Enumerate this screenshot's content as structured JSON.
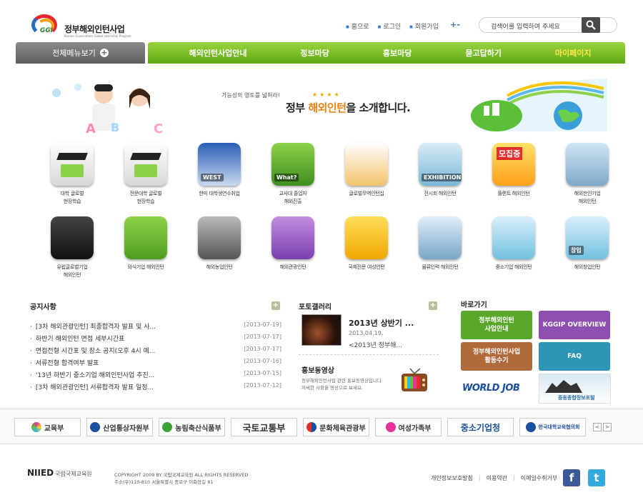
{
  "header": {
    "logo_mark": "GGI",
    "logo_kr": "정부해외인턴사업",
    "logo_en": "Korean Government Global Internship Program",
    "links": [
      "홈으로",
      "로그인",
      "회원가입"
    ],
    "zoom_label": "+-",
    "search_placeholder": "검색어를 입력하여 주세요"
  },
  "nav": {
    "all_menu": "전체메뉴보기",
    "items": [
      "해외인턴사업안내",
      "정보마당",
      "홍보마당",
      "묻고답하기",
      "마이페이지"
    ]
  },
  "banner": {
    "tagline": "가능성의 영토를 넓혀라!",
    "stars": "★★★★",
    "headline_pre": "정부 ",
    "headline_hl": "해외인턴",
    "headline_post": "을 소개합니다."
  },
  "programs": [
    {
      "label": "대학 글로벌\n현장학습",
      "icon": "graduation-cap-icon"
    },
    {
      "label": "전문대학 글로벌\n현장학습",
      "icon": "graduation-cap-icon"
    },
    {
      "label": "한미 대학생연수취업",
      "icon": "west-flag-icon"
    },
    {
      "label": "교사대 졸업자\n해외진출",
      "icon": "question-board-icon"
    },
    {
      "label": "글로벌무역인턴십",
      "icon": "globe-package-icon"
    },
    {
      "label": "전시회 해외인턴",
      "icon": "exhibition-icon"
    },
    {
      "label": "플랜트 해외인턴",
      "icon": "recruit-icon"
    },
    {
      "label": "해외한인기업\n해외인턴",
      "icon": "korea-flag-icon"
    },
    {
      "label": "유럽글로벌기업\n해외인턴",
      "icon": "eu-flag-icon"
    },
    {
      "label": "외식기업 해외인턴",
      "icon": "city-buildings-icon"
    },
    {
      "label": "해외농업인턴",
      "icon": "farm-globe-icon"
    },
    {
      "label": "해외관광인턴",
      "icon": "passport-plane-icon"
    },
    {
      "label": "국제전문 여성인턴",
      "icon": "un-woman-icon"
    },
    {
      "label": "물류인력 해외인턴",
      "icon": "logistics-icon"
    },
    {
      "label": "중소기업 해외인턴",
      "icon": "sme-figure-icon"
    },
    {
      "label": "해외창업인턴",
      "icon": "startup-figure-icon"
    }
  ],
  "program_tile_text": {
    "west": "WEST",
    "what": "What?",
    "exhibition": "EXHIBITION",
    "recruit": "모집중",
    "startup": "창업"
  },
  "notice": {
    "title": "공지사항",
    "more": "+",
    "items": [
      {
        "title": "[3차 해외관광인턴] 최종합격자 발표 및 사...",
        "date": "[2013-07-19]"
      },
      {
        "title": "하반기 해외인턴 면접 세부시간표",
        "date": "[2013-07-17]"
      },
      {
        "title": "면접전형 시간표 및 장소 공지(오후 4시 예...",
        "date": "[2013-07-17]"
      },
      {
        "title": "서류전형 합격여부 발표",
        "date": "[2013-07-16]"
      },
      {
        "title": "'13년 하반기 중소기업 해외인턴사업 추진...",
        "date": "[2013-07-15]"
      },
      {
        "title": "[3차 해외관광인턴] 서류합격자 발표 일정...",
        "date": "[2013-07-12]"
      }
    ]
  },
  "gallery": {
    "title": "포토갤러리",
    "more": "+",
    "item_title": "2013년 상반기 ...",
    "item_date": "2013,04,19,",
    "item_sub": "<2013년 정부해...",
    "video_title": "홍보동영상",
    "video_desc1": "정부해외인턴사업 관련 홍보동영상입니다.",
    "video_desc2": "자세한 사항을 영상으로 보세요."
  },
  "quick": {
    "title": "바로가기",
    "buttons": [
      {
        "label": "정부해외인턴\n사업안내",
        "color": "#5aa82a"
      },
      {
        "label": "KGGIP OVERVIEW",
        "color": "#8e4fb0"
      },
      {
        "label": "정부해외인턴사업\n활동수기",
        "color": "#b06a3c"
      },
      {
        "label": "FAQ",
        "color": "#2d95b5"
      }
    ],
    "worldjob": "WORLD JOB",
    "worldjob_sub": "중동종합정보포털"
  },
  "partners": [
    "교육부",
    "산업통상자원부",
    "농림축산식품부",
    "국토교통부",
    "문화체육관광부",
    "여성가족부",
    "중소기업청",
    "한국대학교육협의회"
  ],
  "partner_nav": [
    "<",
    ">"
  ],
  "footer": {
    "logo": "NIIED",
    "logo_kr": "국립국제교육원",
    "copyright": "COPYRIGHT 2009 BY 국립국제교육원 ALL RIGHTS RESERVED",
    "address": "주소(우)110-810 서울특별시 종로구 이화장길 81",
    "links": [
      "개인정보보호방침",
      "이용약관",
      "이메일수취거부"
    ],
    "social": [
      "f",
      "t"
    ]
  },
  "colors": {
    "nav_green": "#6fb81f",
    "nav_highlight": "#ffe94a",
    "accent_orange": "#f08010"
  }
}
